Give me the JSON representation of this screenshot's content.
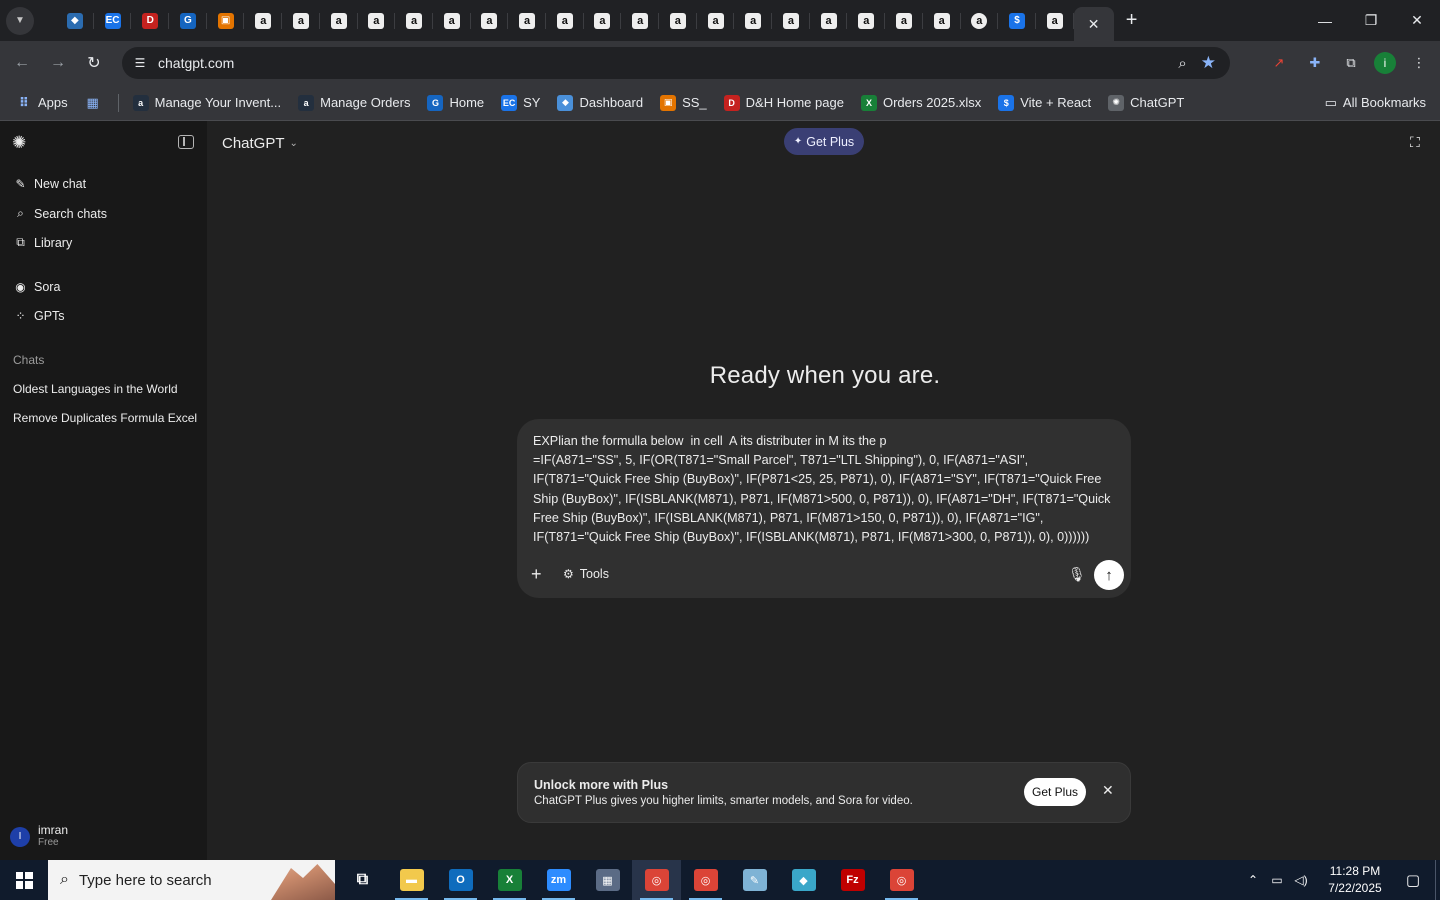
{
  "browser": {
    "url": "chatgpt.com",
    "tabs": [
      {
        "icon": "edge-icon",
        "glyph": "◆",
        "bg": "#2b6cb0"
      },
      {
        "icon": "ec-icon",
        "glyph": "EC",
        "bg": "#1a73e8"
      },
      {
        "icon": "dh-icon",
        "glyph": "D",
        "bg": "#c5221f"
      },
      {
        "icon": "g-icon",
        "glyph": "G",
        "bg": "#1565c0"
      },
      {
        "icon": "box-icon",
        "glyph": "▣",
        "bg": "#e37400"
      },
      {
        "icon": "amazon-icon",
        "glyph": "a",
        "bg": "amazon"
      },
      {
        "icon": "amazon-icon",
        "glyph": "a",
        "bg": "amazon"
      },
      {
        "icon": "amazon-icon",
        "glyph": "a",
        "bg": "amazon"
      },
      {
        "icon": "amazon-icon",
        "glyph": "a",
        "bg": "amazon"
      },
      {
        "icon": "amazon-icon",
        "glyph": "a",
        "bg": "amazon"
      },
      {
        "icon": "amazon-icon",
        "glyph": "a",
        "bg": "amazon"
      },
      {
        "icon": "amazon-icon",
        "glyph": "a",
        "bg": "amazon"
      },
      {
        "icon": "amazon-icon",
        "glyph": "a",
        "bg": "amazon"
      },
      {
        "icon": "amazon-icon",
        "glyph": "a",
        "bg": "amazon"
      },
      {
        "icon": "amazon-icon",
        "glyph": "a",
        "bg": "amazon"
      },
      {
        "icon": "amazon-icon",
        "glyph": "a",
        "bg": "amazon"
      },
      {
        "icon": "amazon-icon",
        "glyph": "a",
        "bg": "amazon"
      },
      {
        "icon": "amazon-icon",
        "glyph": "a",
        "bg": "amazon"
      },
      {
        "icon": "amazon-icon",
        "glyph": "a",
        "bg": "amazon"
      },
      {
        "icon": "amazon-icon",
        "glyph": "a",
        "bg": "amazon"
      },
      {
        "icon": "amazon-icon",
        "glyph": "a",
        "bg": "amazon"
      },
      {
        "icon": "amazon-icon",
        "glyph": "a",
        "bg": "amazon"
      },
      {
        "icon": "amazon-icon",
        "glyph": "a",
        "bg": "amazon"
      },
      {
        "icon": "amazon-icon",
        "glyph": "a",
        "bg": "amazon"
      },
      {
        "icon": "amazon-circle-icon",
        "glyph": "a",
        "bg": "amazon-round"
      },
      {
        "icon": "dollar-icon",
        "glyph": "$",
        "bg": "#1a73e8"
      },
      {
        "icon": "amazon-icon",
        "glyph": "a",
        "bg": "amazon"
      }
    ],
    "bookmarks": [
      {
        "label": "Apps",
        "icon": "apps-grid-icon",
        "glyph": "⠿",
        "bg": "transparent"
      },
      {
        "label": "",
        "icon": "tab-groups-icon",
        "glyph": "▦",
        "bg": "transparent"
      },
      {
        "label": "Manage Your Invent...",
        "icon": "amazon-icon",
        "glyph": "a",
        "bg": "#232f3e"
      },
      {
        "label": "Manage Orders",
        "icon": "amazon-icon",
        "glyph": "a",
        "bg": "#232f3e"
      },
      {
        "label": "Home",
        "icon": "g-icon",
        "glyph": "G",
        "bg": "#1565c0"
      },
      {
        "label": "SY",
        "icon": "ec-icon",
        "glyph": "EC",
        "bg": "#1a73e8"
      },
      {
        "label": "Dashboard",
        "icon": "dashboard-icon",
        "glyph": "◆",
        "bg": "#4a90d9"
      },
      {
        "label": "SS_",
        "icon": "box-icon",
        "glyph": "▣",
        "bg": "#e37400"
      },
      {
        "label": "D&H Home page",
        "icon": "dh-icon",
        "glyph": "D",
        "bg": "#c5221f"
      },
      {
        "label": "Orders 2025.xlsx",
        "icon": "excel-icon",
        "glyph": "X",
        "bg": "#188038"
      },
      {
        "label": "Vite + React",
        "icon": "dollar-icon",
        "glyph": "$",
        "bg": "#1a73e8"
      },
      {
        "label": "ChatGPT",
        "icon": "chatgpt-icon",
        "glyph": "✺",
        "bg": "#5f6368"
      }
    ],
    "all_bookmarks": "All Bookmarks"
  },
  "app": {
    "title": "ChatGPT",
    "get_plus": "Get Plus",
    "hero": "Ready when you are."
  },
  "sidebar": {
    "items": [
      {
        "label": "New chat",
        "icon": "edit-icon",
        "glyph": "✎"
      },
      {
        "label": "Search chats",
        "icon": "search-icon",
        "glyph": "⌕"
      },
      {
        "label": "Library",
        "icon": "library-icon",
        "glyph": "⧉"
      },
      {
        "label": "Sora",
        "icon": "sora-icon",
        "glyph": "◉"
      },
      {
        "label": "GPTs",
        "icon": "gpts-icon",
        "glyph": "⁘"
      }
    ],
    "chats_label": "Chats",
    "chats": [
      "Oldest Languages in the World",
      "Remove Duplicates Formula Excel"
    ],
    "user": {
      "initial": "I",
      "name": "imran",
      "plan": "Free"
    }
  },
  "composer": {
    "line1": "EXPlian the formulla below  in cell  A its distributer in M its the p",
    "formula": "=IF(A871=\"SS\", 5, IF(OR(T871=\"Small Parcel\", T871=\"LTL Shipping\"), 0, IF(A871=\"ASI\", IF(T871=\"Quick Free Ship (BuyBox)\", IF(P871<25, 25, P871), 0), IF(A871=\"SY\", IF(T871=\"Quick Free Ship (BuyBox)\", IF(ISBLANK(M871), P871, IF(M871>500, 0, P871)), 0), IF(A871=\"DH\", IF(T871=\"Quick Free Ship (BuyBox)\", IF(ISBLANK(M871), P871, IF(M871>150, 0, P871)), 0), IF(A871=\"IG\", IF(T871=\"Quick Free Ship (BuyBox)\", IF(ISBLANK(M871), P871, IF(M871>300, 0, P871)), 0), 0))))))",
    "tools_label": "Tools"
  },
  "upsell": {
    "title": "Unlock more with Plus",
    "body": "ChatGPT Plus gives you higher limits, smarter models, and Sora for video.",
    "button": "Get Plus"
  },
  "taskbar": {
    "search_placeholder": "Type here to search",
    "apps": [
      {
        "icon": "task-view-icon",
        "glyph": "⧉",
        "bg": "transparent",
        "open": false,
        "active": false
      },
      {
        "icon": "file-explorer-icon",
        "glyph": "▬",
        "bg": "#f2c94c",
        "open": true,
        "active": false
      },
      {
        "icon": "outlook-icon",
        "glyph": "O",
        "bg": "#0f6cbd",
        "open": true,
        "active": false
      },
      {
        "icon": "excel-icon",
        "glyph": "X",
        "bg": "#188038",
        "open": true,
        "active": false
      },
      {
        "icon": "zoom-icon",
        "glyph": "zm",
        "bg": "#2d8cff",
        "open": true,
        "active": false
      },
      {
        "icon": "calculator-icon",
        "glyph": "▦",
        "bg": "#5b6b85",
        "open": false,
        "active": false
      },
      {
        "icon": "chrome-icon",
        "glyph": "◎",
        "bg": "#db4437",
        "open": true,
        "active": true
      },
      {
        "icon": "chrome-icon",
        "glyph": "◎",
        "bg": "#db4437",
        "open": true,
        "active": false
      },
      {
        "icon": "notepad-icon",
        "glyph": "✎",
        "bg": "#7fb3d5",
        "open": false,
        "active": false
      },
      {
        "icon": "app-diamond-icon",
        "glyph": "◆",
        "bg": "#3aa7c9",
        "open": false,
        "active": false
      },
      {
        "icon": "filezilla-icon",
        "glyph": "Fz",
        "bg": "#bf0000",
        "open": false,
        "active": false
      },
      {
        "icon": "chrome-profile-icon",
        "glyph": "◎",
        "bg": "#db4437",
        "open": true,
        "active": false
      }
    ],
    "time": "11:28 PM",
    "date": "7/22/2025"
  }
}
